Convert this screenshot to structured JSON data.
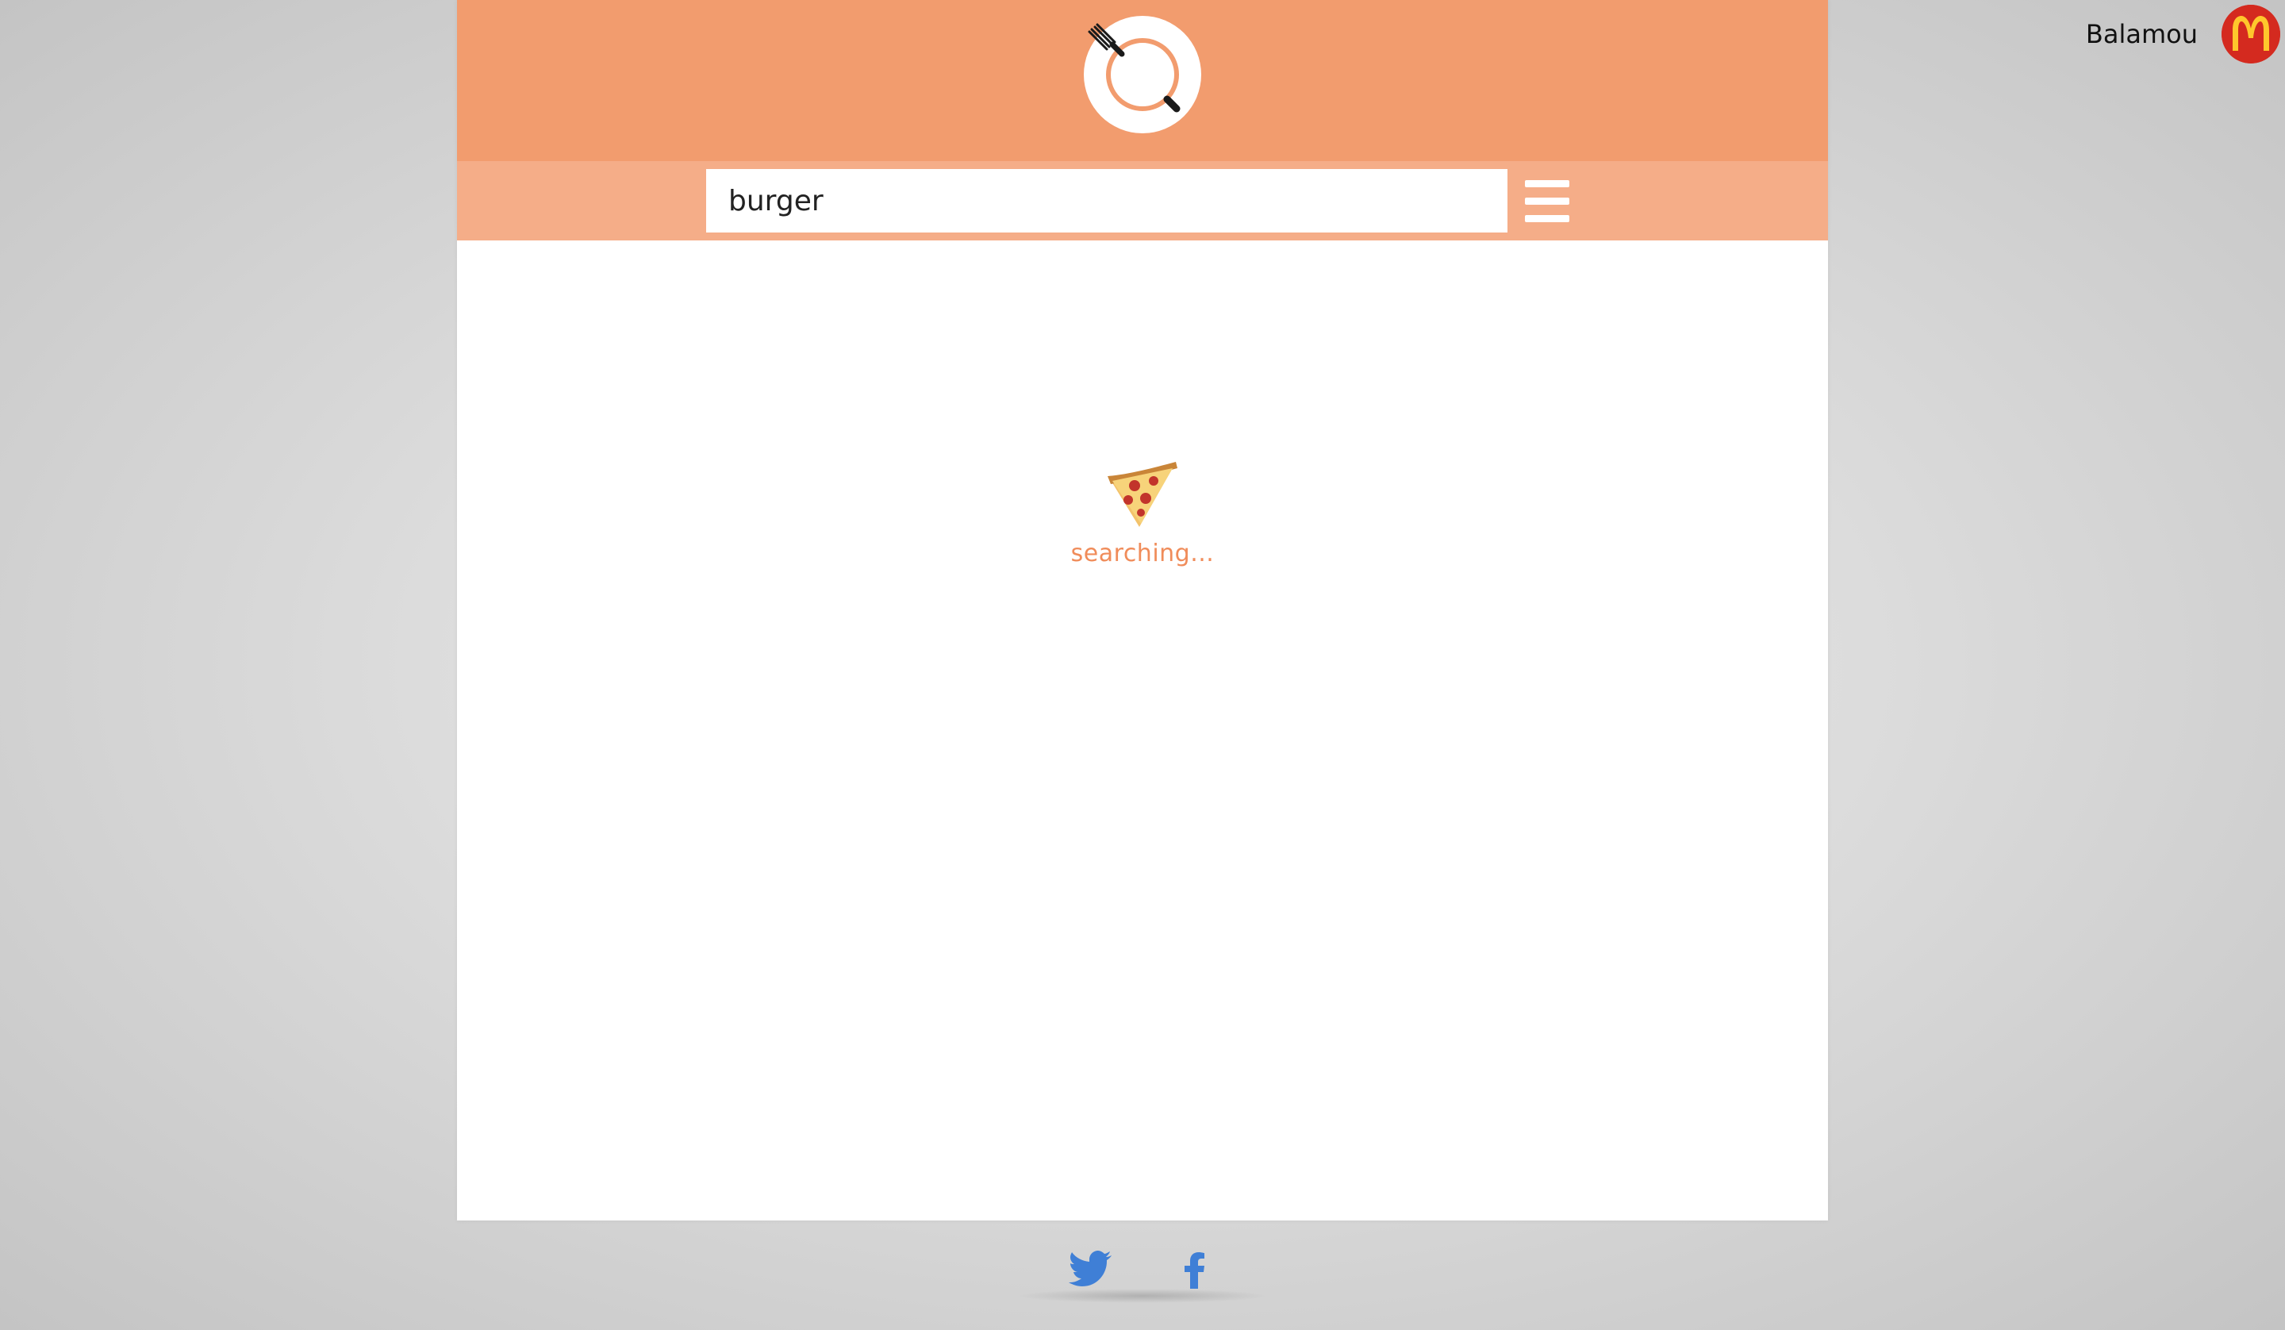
{
  "user": {
    "name": "Balamou",
    "avatar_icon": "mcdonalds-logo-icon",
    "avatar_color": "#d42a1f"
  },
  "header": {
    "logo_icon": "plate-fork-search-icon",
    "background_color": "#f29c6e"
  },
  "search": {
    "value": "burger",
    "placeholder": "",
    "bar_color": "#f5ad88"
  },
  "menu": {
    "icon": "hamburger-menu-icon"
  },
  "loader": {
    "icon": "pizza-slice-icon",
    "text": "searching...",
    "text_color": "#f08c5a"
  },
  "footer": {
    "links": [
      {
        "name": "twitter",
        "icon": "twitter-bird-icon",
        "color": "#3f7fd6"
      },
      {
        "name": "facebook",
        "icon": "facebook-f-icon",
        "color": "#3f7fd6"
      }
    ]
  }
}
